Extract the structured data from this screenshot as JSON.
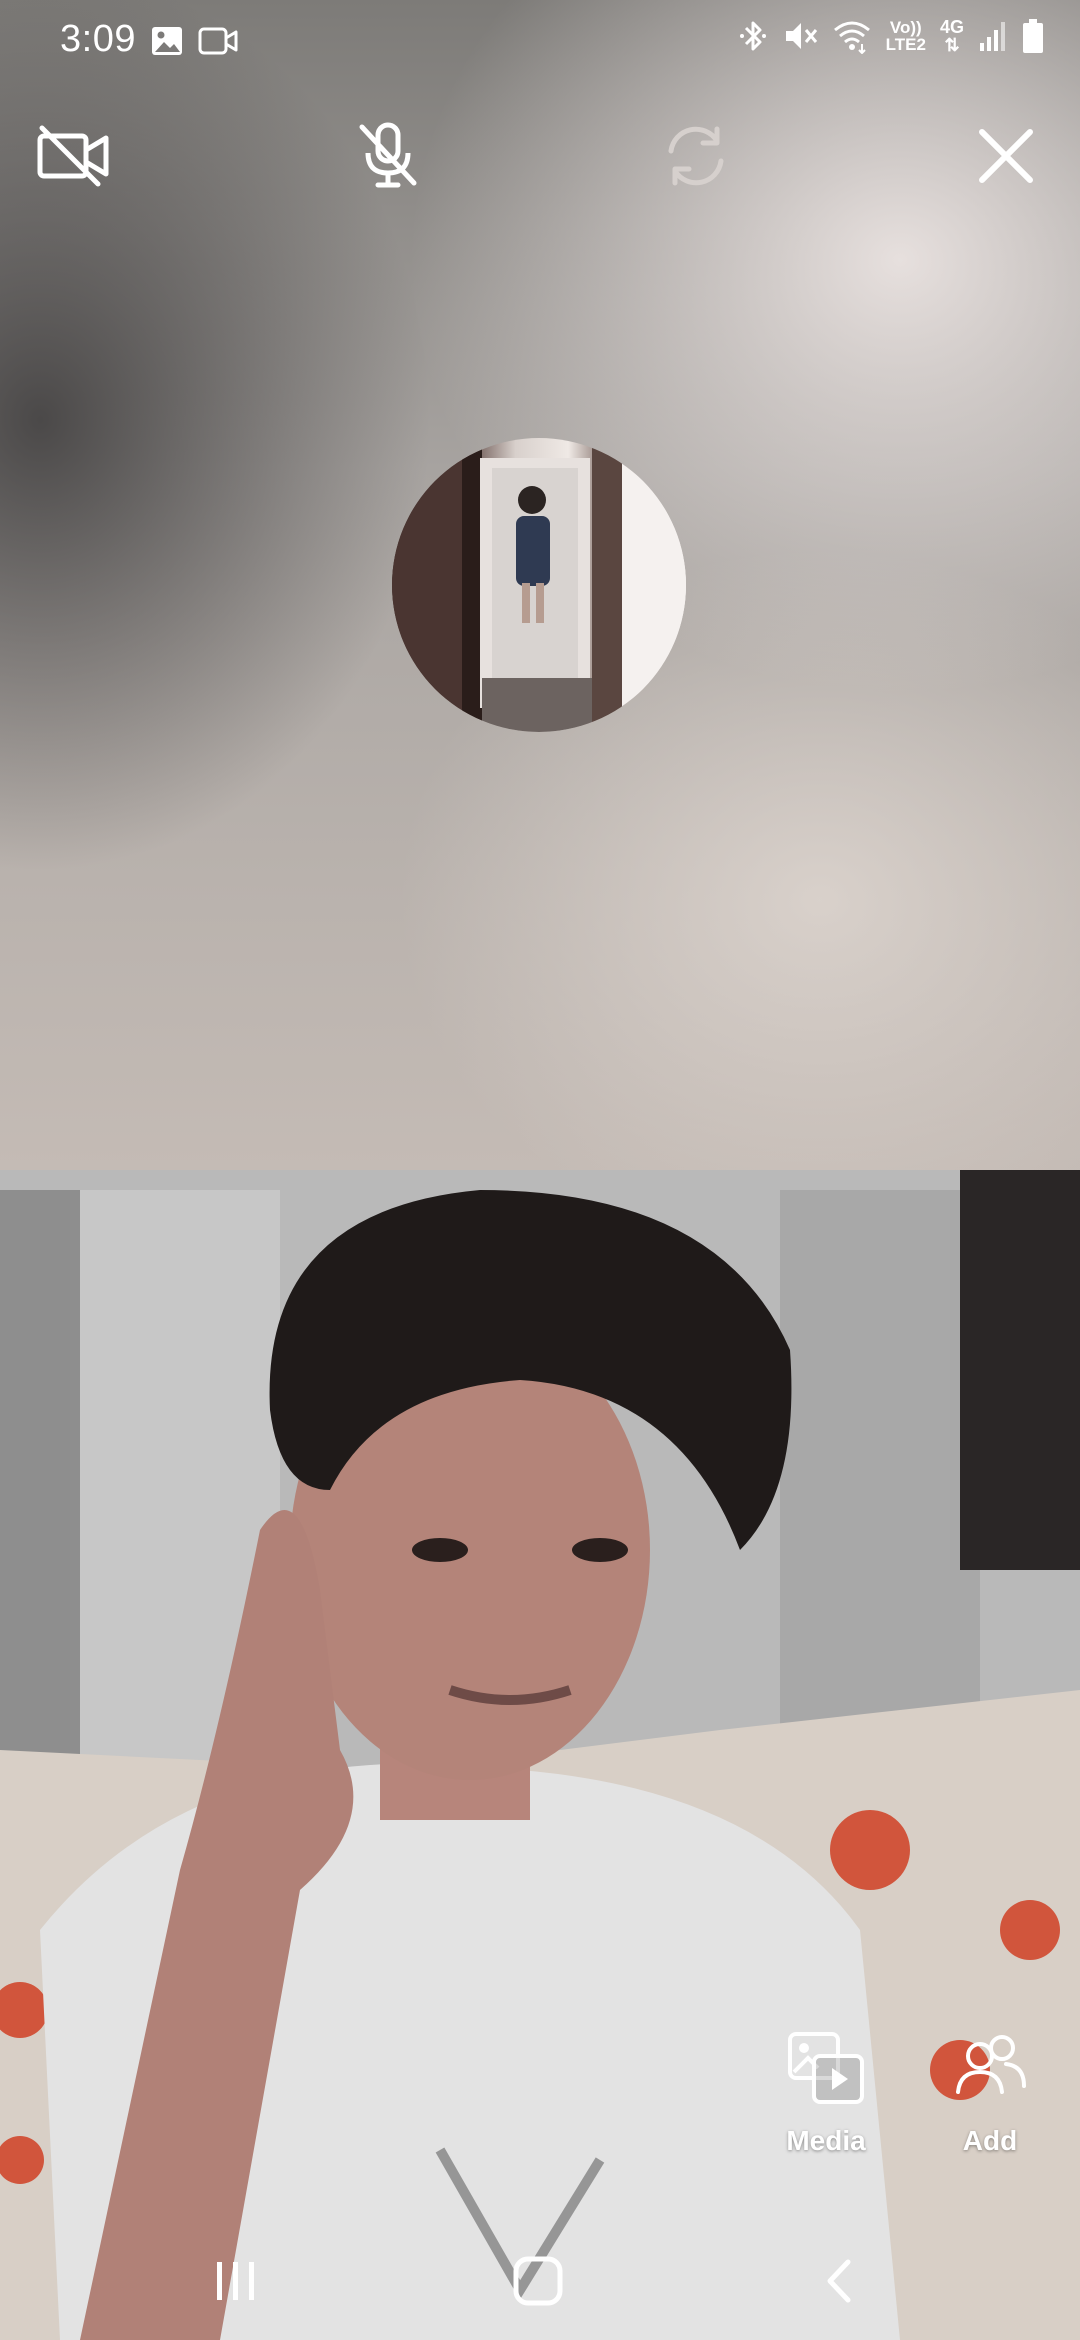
{
  "status_bar": {
    "time": "3:09",
    "icons_left": [
      "gallery-icon",
      "video-recorder-icon"
    ],
    "icons_right": [
      "bluetooth-icon",
      "mute-icon",
      "wifi-icon",
      "volte-indicator",
      "network-4g-indicator",
      "signal-icon",
      "battery-icon"
    ],
    "volte_line1": "Vo))",
    "volte_line2": "LTE2",
    "network_type": "4G"
  },
  "call_controls": {
    "camera_off": {
      "icon": "camera-off-icon"
    },
    "mic_off": {
      "icon": "mic-off-icon"
    },
    "flip_camera": {
      "icon": "flip-camera-icon",
      "enabled": false
    },
    "end_call": {
      "icon": "close-icon"
    }
  },
  "remote": {
    "avatar": {
      "icon": "avatar"
    }
  },
  "actions": {
    "media_label": "Media",
    "add_label": "Add"
  },
  "nav_bar": {
    "icons": [
      "recents-icon",
      "home-icon",
      "back-icon"
    ]
  },
  "colors": {
    "icon_white": "#ffffff",
    "icon_disabled": "#d6d0cd"
  }
}
